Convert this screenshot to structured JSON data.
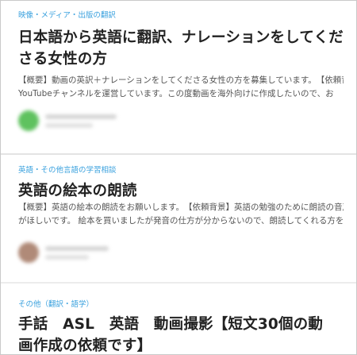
{
  "jobs": [
    {
      "category": "映像・メディア・出版の翻訳",
      "title": "日本語から英語に翻訳、ナレーションをしてくださる女性の方",
      "desc_line1": "【概要】動画の英訳＋ナレーションをしてくださる女性の方を募集しています。　【依頼背景】",
      "desc_line2": "YouTubeチャンネルを運営しています。この度動画を海外向けに作成したいので、お",
      "avatar_color": "#5fc25f"
    },
    {
      "category": "英語・その他言語の学習相談",
      "title": "英語の絵本の朗読",
      "desc_line1": "【概要】英語の絵本の朗読をお願いします。　【依頼背景】英語の勉強のために朗読の音声",
      "desc_line2": "がほしいです。 絵本を買いましたが発音の仕方が分からないので、朗読してくれる方を探",
      "avatar_color": "#b08a78"
    },
    {
      "category": "その他（翻訳・語学）",
      "title": "手話　ASL　英語　動画撮影【短文30個の動画作成の依頼です】"
    }
  ],
  "colors": {
    "accent": "#3aa1de",
    "title": "#222222",
    "text": "#555555"
  }
}
